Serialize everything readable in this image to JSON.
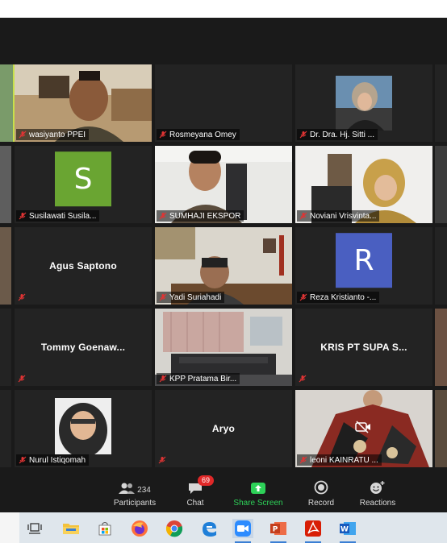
{
  "colors": {
    "background": "#1a1a1a",
    "tile": "#232323",
    "avatar_green": "#6aa532",
    "avatar_blue": "#4a5fc1",
    "mute_red": "#e03434",
    "share_green": "#2dd158",
    "badge_red": "#e02828"
  },
  "participants": [
    {
      "name": "wasiyanto PPEI",
      "type": "video"
    },
    {
      "name": "Rosmeyana Omey",
      "type": "blank"
    },
    {
      "name": "Dr. Dra. Hj. Sitti ...",
      "type": "photo"
    },
    {
      "name": "Susilawati Susila...",
      "type": "avatar",
      "initial": "S"
    },
    {
      "name": "SUMHAJI EKSPOR",
      "type": "video"
    },
    {
      "name": "Noviani Vrisvinta...",
      "type": "video"
    },
    {
      "name": "Agus Saptono",
      "type": "name-only"
    },
    {
      "name": "Yadi Suriahadi",
      "type": "video"
    },
    {
      "name": "Reza Kristianto -...",
      "type": "avatar",
      "initial": "R"
    },
    {
      "name": "Tommy  Goenaw...",
      "type": "name-only"
    },
    {
      "name": "KPP Pratama Bir...",
      "type": "video"
    },
    {
      "name": "KRIS PT SUPA S...",
      "type": "name-only"
    },
    {
      "name": "Nurul Istiqomah",
      "type": "photo"
    },
    {
      "name": "Aryo",
      "type": "name-only"
    },
    {
      "name": "leoni KAINRATU ...",
      "type": "video"
    }
  ],
  "toolbar": {
    "participants_label": "Participants",
    "participants_count": "234",
    "chat_label": "Chat",
    "chat_badge": "69",
    "share_label": "Share Screen",
    "record_label": "Record",
    "reactions_label": "Reactions"
  },
  "taskbar_icons": [
    "task-view-icon",
    "file-explorer-icon",
    "store-icon",
    "firefox-icon",
    "chrome-icon",
    "edge-icon",
    "zoom-icon",
    "powerpoint-icon",
    "acrobat-icon",
    "word-icon"
  ]
}
